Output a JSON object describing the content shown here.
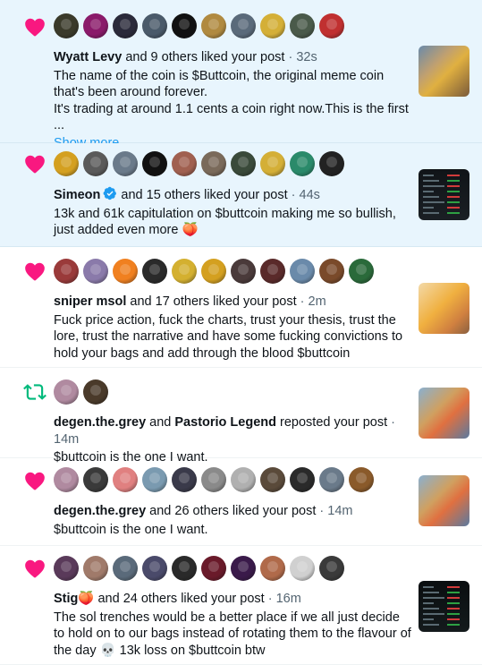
{
  "colors": {
    "like": "#f91880",
    "repost": "#00ba7c",
    "link": "#1d9bf0",
    "verified": "#1d9bf0",
    "unread_bg": "#e8f5fd"
  },
  "notifications": [
    {
      "type": "like",
      "icon": "heart-icon",
      "unread": true,
      "avatar_colors": [
        "#3a3a2a",
        "#8a1a6a",
        "#2a2a3a",
        "#4a5a6a",
        "#111111",
        "#b08a40",
        "#5a6a7a",
        "#d4af37",
        "#4a5a4a",
        "#c03030"
      ],
      "user": "Wyatt Levy",
      "others": "and 9 others liked your post",
      "dot": "·",
      "time": "32s",
      "lines": [
        "The name of the coin is $Buttcoin, the original meme coin that's been around forever.",
        "It's trading at around 1.1 cents a coin right now.This is the first ..."
      ],
      "show_more": "Show more",
      "thumb": "art"
    },
    {
      "type": "like",
      "icon": "heart-icon",
      "unread": true,
      "avatar_colors": [
        "#d4a020",
        "#5a5a5a",
        "#6a7a8a",
        "#111111",
        "#a06050",
        "#7a6a5a",
        "#3a4a3a",
        "#d4af37",
        "#2a8a6a",
        "#222222"
      ],
      "user": "Simeon",
      "verified": true,
      "others": "and 15 others liked your post",
      "dot": "·",
      "time": "44s",
      "lines": [
        "13k and 61k capitulation on $buttcoin making me so bullish, just added even more 🍑"
      ],
      "thumb": "chart"
    },
    {
      "type": "like",
      "icon": "heart-icon",
      "unread": false,
      "avatar_colors": [
        "#9a3a3a",
        "#8a7aaa",
        "#f08020",
        "#2a2a2a",
        "#d4b030",
        "#d4a020",
        "#4a3a3a",
        "#5a2a2a",
        "#6a8aaa",
        "#7a4a2a",
        "#2a6a3a"
      ],
      "user": "sniper msol",
      "others": "and 17 others liked your post",
      "dot": "·",
      "time": "2m",
      "lines": [
        "Fuck price action, fuck the charts, trust your thesis, trust the lore, trust the narrative and have some fucking convictions to hold your bags and add through the blood $buttcoin"
      ],
      "thumb": "warm"
    },
    {
      "type": "repost",
      "icon": "repost-icon",
      "unread": false,
      "avatar_colors": [
        "#b08aa0",
        "#4a3a2a"
      ],
      "user": "degen.the.grey",
      "joiner": "and",
      "user2": "Pastorio Legend",
      "others": "reposted your post",
      "dot": "·",
      "time": "14m",
      "lines": [
        "$buttcoin is the one I want."
      ],
      "thumb": "art2"
    },
    {
      "type": "like",
      "icon": "heart-icon",
      "unread": false,
      "avatar_colors": [
        "#b08aa0",
        "#3a3a3a",
        "#e08080",
        "#7a9ab0",
        "#3a3a4a",
        "#8a8a8a",
        "#b0b0b0",
        "#5a4a3a",
        "#2a2a2a",
        "#6a7a8a",
        "#8a5a2a"
      ],
      "user": "degen.the.grey",
      "others": "and 26 others liked your post",
      "dot": "·",
      "time": "14m",
      "lines": [
        "$buttcoin is the one I want."
      ],
      "thumb": "art2"
    },
    {
      "type": "like",
      "icon": "heart-icon",
      "unread": false,
      "avatar_colors": [
        "#5a3a5a",
        "#a07a6a",
        "#5a6a7a",
        "#4a4a6a",
        "#2a2a2a",
        "#6a1a2a",
        "#3a1a4a",
        "#b06a4a",
        "#d0d0d0",
        "#3a3a3a"
      ],
      "user": "Stig🍑",
      "others": "and 24 others liked your post",
      "dot": "·",
      "time": "16m",
      "lines": [
        "The sol trenches would be a better place if we all just decide to hold on to our bags instead of rotating them to the flavour of the day 💀 13k loss on $buttcoin btw"
      ],
      "thumb": "chart2"
    }
  ]
}
